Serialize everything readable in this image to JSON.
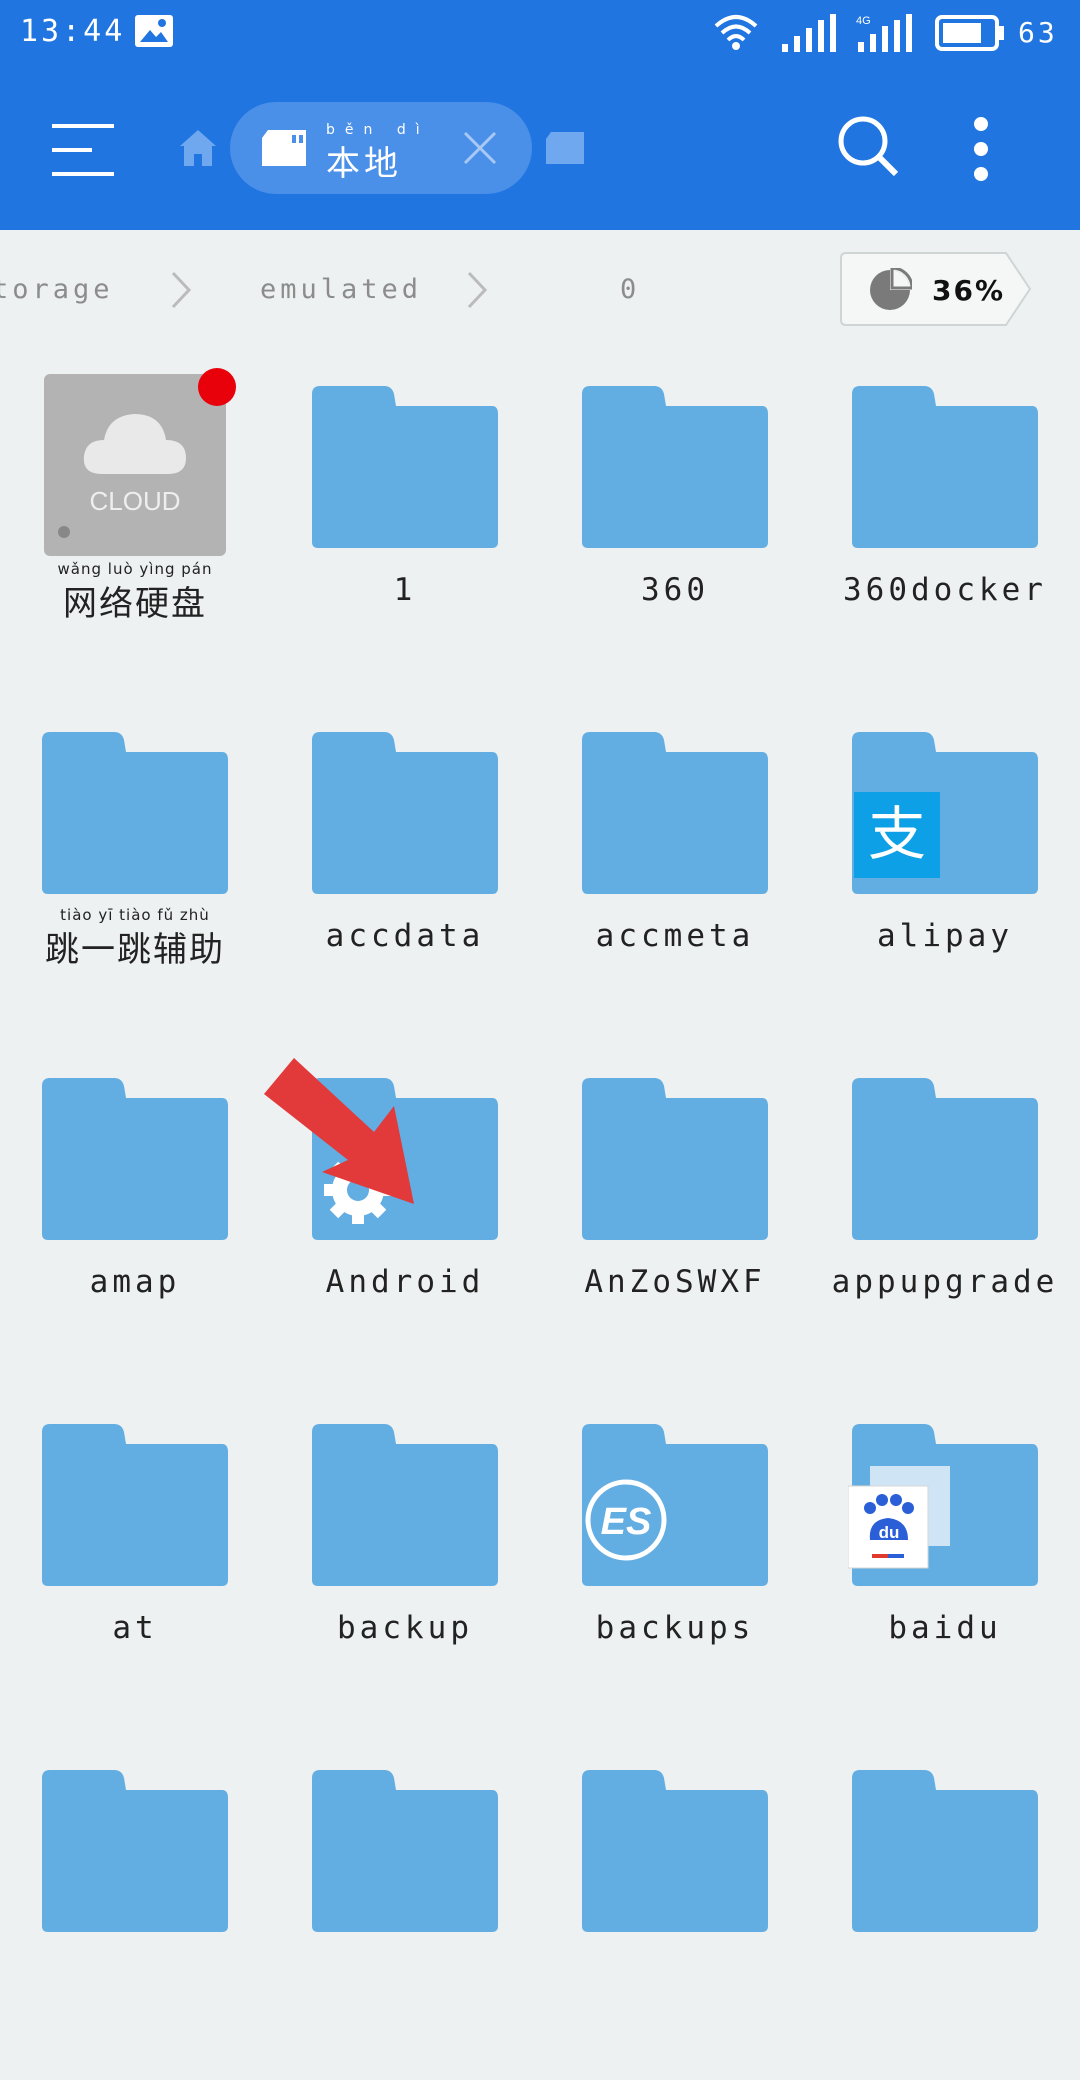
{
  "status_bar": {
    "time": "13:44",
    "battery": "63",
    "network": "4G"
  },
  "toolbar": {
    "location_label": "本地",
    "location_pinyin": "běn dì"
  },
  "breadcrumb": {
    "items": [
      "torage",
      "emulated",
      "0"
    ],
    "storage_percent": "36%"
  },
  "colors": {
    "primary": "#2075e0",
    "folder": "#62ade2",
    "background": "#eef1f1",
    "badge": "#e8000b"
  },
  "files": [
    {
      "name": "网络硬盘",
      "pinyin": "wǎng luò yìng pán",
      "type": "cloud",
      "badge_text": "CLOUD"
    },
    {
      "name": "1",
      "type": "folder"
    },
    {
      "name": "360",
      "type": "folder"
    },
    {
      "name": "360docker",
      "type": "folder"
    },
    {
      "name": "跳一跳辅助",
      "pinyin": "tiào yī tiào fǔ zhù",
      "type": "folder"
    },
    {
      "name": "accdata",
      "type": "folder"
    },
    {
      "name": "accmeta",
      "type": "folder"
    },
    {
      "name": "alipay",
      "type": "folder",
      "overlay": "alipay-icon",
      "overlay_text": "支"
    },
    {
      "name": "amap",
      "type": "folder"
    },
    {
      "name": "Android",
      "type": "folder",
      "overlay": "gear-icon"
    },
    {
      "name": "AnZoSWXF",
      "type": "folder"
    },
    {
      "name": "appupgrade",
      "type": "folder"
    },
    {
      "name": "at",
      "type": "folder"
    },
    {
      "name": "backup",
      "type": "folder"
    },
    {
      "name": "backups",
      "type": "folder",
      "overlay": "es-icon",
      "overlay_text": "ES"
    },
    {
      "name": "baidu",
      "type": "folder",
      "overlay": "baidu-icon",
      "overlay_text": "du"
    },
    {
      "name": "",
      "type": "folder"
    },
    {
      "name": "",
      "type": "folder"
    },
    {
      "name": "",
      "type": "folder"
    },
    {
      "name": "",
      "type": "folder"
    }
  ]
}
